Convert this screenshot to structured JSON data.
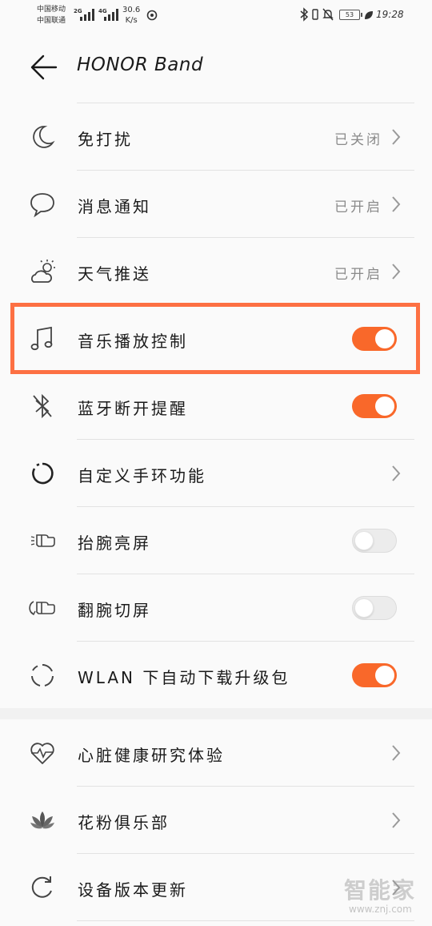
{
  "status_bar": {
    "carrier_1": "中国移动",
    "carrier_2": "中国联通",
    "net_1": "2G",
    "net_2": "4G",
    "speed_value": "30.6",
    "speed_unit": "K/s",
    "battery": "53",
    "time": "19:28"
  },
  "header": {
    "title": "HONOR Band"
  },
  "settings": [
    {
      "label": "免打扰",
      "value": "已关闭",
      "control": "chevron",
      "icon": "moon-icon"
    },
    {
      "label": "消息通知",
      "value": "已开启",
      "control": "chevron",
      "icon": "message-bubble-icon"
    },
    {
      "label": "天气推送",
      "value": "已开启",
      "control": "chevron",
      "icon": "weather-icon"
    },
    {
      "label": "音乐播放控制",
      "control": "toggle",
      "state": "on",
      "icon": "music-note-icon"
    },
    {
      "label": "蓝牙断开提醒",
      "control": "toggle",
      "state": "on",
      "icon": "bluetooth-off-icon"
    },
    {
      "label": "自定义手环功能",
      "control": "chevron",
      "icon": "circle-progress-icon"
    },
    {
      "label": "抬腕亮屏",
      "control": "toggle",
      "state": "off",
      "icon": "wrist-raise-icon"
    },
    {
      "label": "翻腕切屏",
      "control": "toggle",
      "state": "off",
      "icon": "wrist-flip-icon"
    },
    {
      "label": "WLAN 下自动下载升级包",
      "control": "toggle",
      "state": "on",
      "icon": "update-cycle-icon"
    },
    {
      "label": "心脏健康研究体验",
      "control": "chevron",
      "icon": "heart-pulse-icon"
    },
    {
      "label": "花粉俱乐部",
      "control": "chevron",
      "icon": "lotus-icon"
    },
    {
      "label": "设备版本更新",
      "control": "chevron",
      "icon": "refresh-icon"
    }
  ],
  "colors": {
    "accent": "#f9682a",
    "highlight_border": "#fd7043"
  },
  "watermark": {
    "logo": "智能家",
    "url": "www.znj.com"
  }
}
